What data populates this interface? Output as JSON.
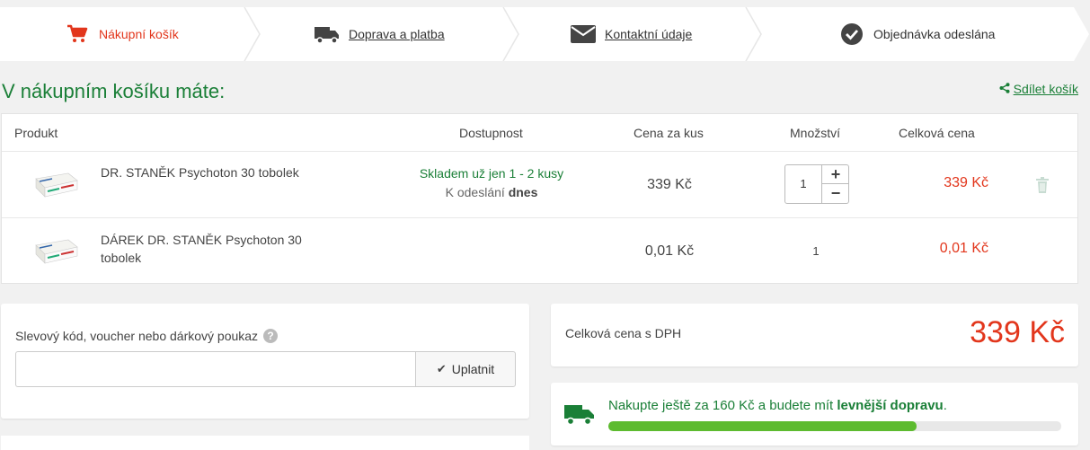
{
  "steps": [
    {
      "label": "Nákupní košík",
      "icon": "cart-icon",
      "active": true
    },
    {
      "label": "Doprava a platba",
      "icon": "truck-icon",
      "active": false
    },
    {
      "label": "Kontaktní údaje",
      "icon": "envelope-icon",
      "active": false
    },
    {
      "label": "Objednávka odeslána",
      "icon": "check-circle-icon",
      "active": false
    }
  ],
  "cart_title": "V nákupním košíku máte:",
  "share_label": "Sdílet košík",
  "table": {
    "headers": {
      "product": "Produkt",
      "availability": "Dostupnost",
      "unit_price": "Cena za kus",
      "quantity": "Množství",
      "total": "Celková cena"
    },
    "rows": [
      {
        "name": "DR. STANĚK Psychoton 30 tobolek",
        "stock": "Skladem už jen 1 - 2 kusy",
        "ship_prefix": "K odeslání",
        "ship_when": "dnes",
        "unit_price": "339 Kč",
        "quantity": "1",
        "total": "339 Kč"
      },
      {
        "name": "DÁREK DR. STANĚK Psychoton 30 tobolek",
        "unit_price": "0,01 Kč",
        "quantity": "1",
        "total": "0,01 Kč"
      }
    ]
  },
  "voucher": {
    "label": "Slevový kód, voucher nebo dárkový poukaz",
    "value": "",
    "button": "Uplatnit"
  },
  "summary": {
    "label": "Celková cena s DPH",
    "price": "339 Kč"
  },
  "shipping": {
    "msg_prefix": "Nakupte ještě za 160 Kč a budete mít ",
    "msg_bold": "levnější dopravu",
    "msg_suffix": ".",
    "progress": 0.68
  },
  "colors": {
    "accent_red": "#e2361c",
    "accent_green": "#1a7f37",
    "progress_green": "#5dbb2f"
  }
}
